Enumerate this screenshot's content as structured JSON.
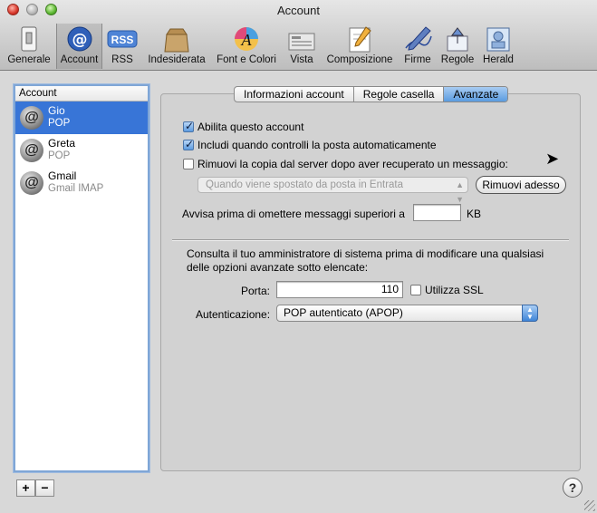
{
  "window": {
    "title": "Account"
  },
  "toolbar": {
    "items": [
      {
        "label": "Generale",
        "icon": "light-switch-icon"
      },
      {
        "label": "Account",
        "icon": "at-sign-icon"
      },
      {
        "label": "RSS",
        "icon": "rss-icon"
      },
      {
        "label": "Indesiderata",
        "icon": "junk-bag-icon"
      },
      {
        "label": "Font e Colori",
        "icon": "font-colors-icon"
      },
      {
        "label": "Vista",
        "icon": "view-icon"
      },
      {
        "label": "Composizione",
        "icon": "compose-icon"
      },
      {
        "label": "Firme",
        "icon": "signature-pen-icon"
      },
      {
        "label": "Regole",
        "icon": "rules-icon"
      },
      {
        "label": "Herald",
        "icon": "herald-icon"
      }
    ],
    "rss_badge": "RSS",
    "selected": "Account"
  },
  "sidebar": {
    "header": "Account",
    "accounts": [
      {
        "name": "Gio",
        "type": "POP",
        "selected": true
      },
      {
        "name": "Greta",
        "type": "POP",
        "selected": false
      },
      {
        "name": "Gmail",
        "type": "Gmail IMAP",
        "selected": false
      }
    ],
    "add_label": "+",
    "remove_label": "−"
  },
  "tabs": [
    {
      "label": "Informazioni account",
      "active": false
    },
    {
      "label": "Regole casella",
      "active": false
    },
    {
      "label": "Avanzate",
      "active": true
    }
  ],
  "advanced": {
    "enable_account": {
      "label": "Abilita questo account",
      "checked": true
    },
    "include_check": {
      "label": "Includi quando controlli la posta automaticamente",
      "checked": true
    },
    "remove_copy": {
      "label": "Rimuovi la copia dal server dopo aver recuperato un messaggio:",
      "checked": false
    },
    "remove_when": "Quando viene spostato da posta in Entrata",
    "remove_now_button": "Rimuovi adesso",
    "warn_label": "Avvisa prima di omettere messaggi superiori a",
    "warn_value": "",
    "warn_unit": "KB",
    "admin_note_line1": "Consulta il tuo amministratore di sistema prima di modificare una qualsiasi",
    "admin_note_line2": "delle opzioni avanzate sotto elencate:",
    "port_label": "Porta:",
    "port_value": "110",
    "ssl": {
      "label": "Utilizza SSL",
      "checked": false
    },
    "auth_label": "Autenticazione:",
    "auth_value": "POP autenticato (APOP)"
  },
  "help_label": "?",
  "colors": {
    "selection": "#3875d7",
    "active_tab": "#5a9be0"
  }
}
